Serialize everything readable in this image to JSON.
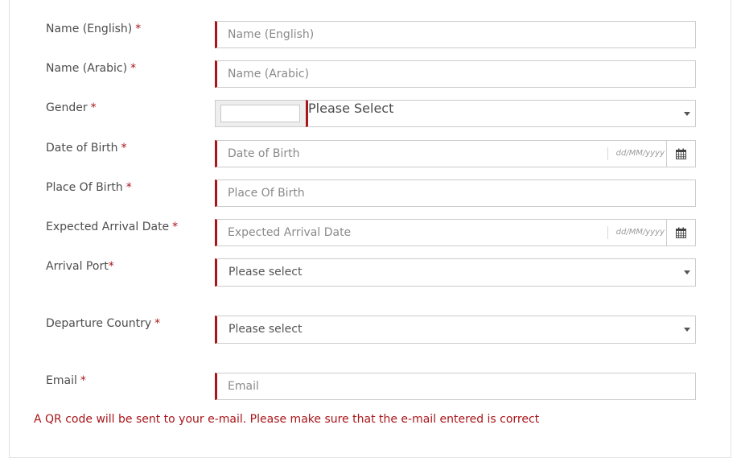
{
  "form": {
    "name_en": {
      "label": "Name (English)",
      "required": "*",
      "placeholder": "Name (English)"
    },
    "name_ar": {
      "label": "Name (Arabic)",
      "required": "*",
      "placeholder": "Name (Arabic)"
    },
    "gender": {
      "label": "Gender",
      "required": "*",
      "value": "Please Select"
    },
    "dob": {
      "label": "Date of Birth",
      "required": "*",
      "placeholder": "Date of Birth",
      "format": "dd/MM/yyyy"
    },
    "pob": {
      "label": "Place Of Birth",
      "required": "*",
      "placeholder": "Place Of Birth"
    },
    "arrival_date": {
      "label": "Expected Arrival Date",
      "required": "*",
      "placeholder": "Expected Arrival Date",
      "format": "dd/MM/yyyy"
    },
    "arrival_port": {
      "label": "Arrival Port",
      "required": "*",
      "value": "Please select"
    },
    "departure_country": {
      "label": "Departure Country",
      "required": "*",
      "value": "Please select"
    },
    "email": {
      "label": "Email",
      "required": "*",
      "placeholder": "Email"
    }
  },
  "note": "A QR code will be sent to your e-mail. Please make sure that the e-mail entered is correct",
  "colors": {
    "accent": "#a8151a",
    "border": "#cccccc"
  },
  "icons": {
    "calendar": "calendar-icon",
    "dropdown": "caret-down-icon"
  }
}
